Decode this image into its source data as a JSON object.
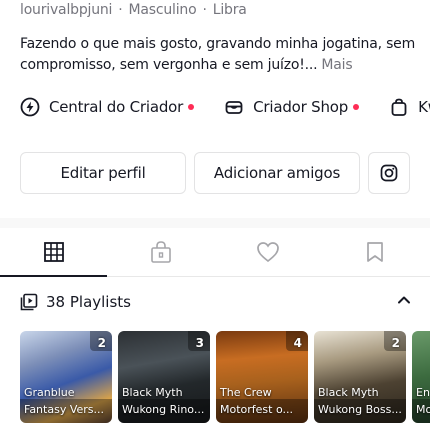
{
  "profile": {
    "username": "lourivalbpjuni",
    "gender": "Masculino",
    "sign": "Libra",
    "bio": "Fazendo o que mais gosto, gravando minha jogatina, sem compromisso, sem vergonha e sem juízo!...",
    "bio_more": "Mais"
  },
  "links": [
    {
      "label": "Central do Criador",
      "icon": "lightning-circle-icon",
      "dot": true
    },
    {
      "label": "Criador Shop",
      "icon": "cart-icon",
      "dot": true
    },
    {
      "label": "Kwa",
      "icon": "bag-icon",
      "dot": false
    }
  ],
  "buttons": {
    "edit_profile": "Editar perfil",
    "add_friends": "Adicionar amigos",
    "instagram_icon": "instagram-icon"
  },
  "tabs": [
    {
      "name": "videos-grid",
      "icon": "grid-icon",
      "active": true
    },
    {
      "name": "private",
      "icon": "lock-bag-icon",
      "active": false
    },
    {
      "name": "liked",
      "icon": "heart-icon",
      "active": false
    },
    {
      "name": "saved",
      "icon": "bookmark-icon",
      "active": false
    }
  ],
  "playlists": {
    "header": "38 Playlists",
    "items": [
      {
        "count": "2",
        "line1": "Granblue",
        "line2": "Fantasy Vers..."
      },
      {
        "count": "3",
        "line1": "Black Myth",
        "line2": "Wukong Rino..."
      },
      {
        "count": "4",
        "line1": "The Crew",
        "line2": "Motorfest o..."
      },
      {
        "count": "2",
        "line1": "Black Myth",
        "line2": "Wukong Boss..."
      },
      {
        "count": "",
        "line1": "En",
        "line2": "Mo"
      }
    ]
  },
  "colors": {
    "accent_dot": "#fe2c55",
    "text": "#161823",
    "muted": "#75757d"
  }
}
